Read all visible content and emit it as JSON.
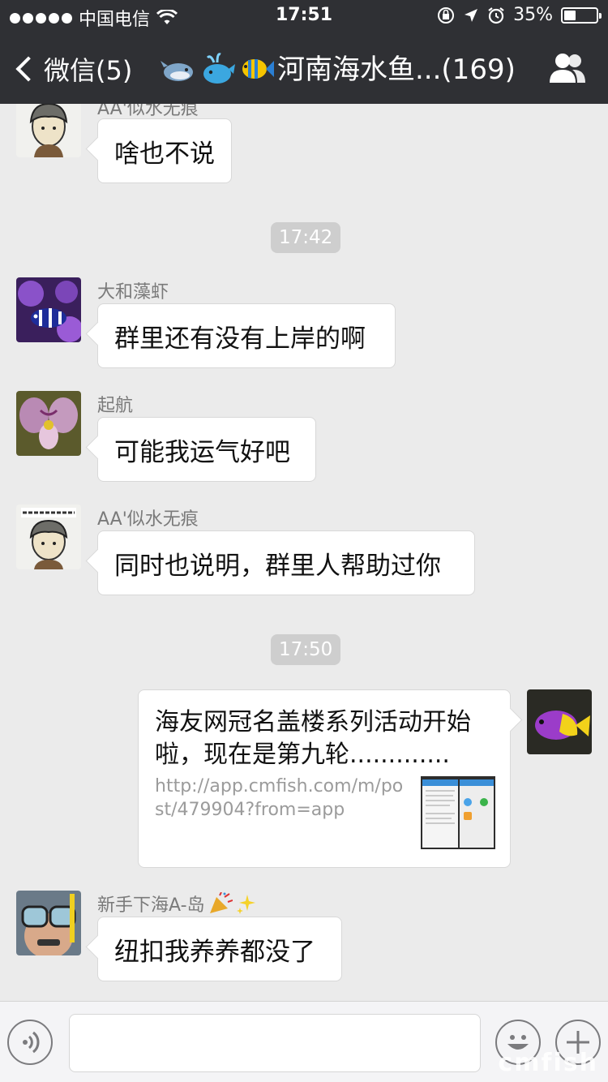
{
  "status_bar": {
    "carrier": "中国电信",
    "time": "17:51",
    "battery": "35%",
    "battery_level": 0.35
  },
  "nav": {
    "back_label": "微信(5)",
    "title": "河南海水鱼...(169)"
  },
  "messages": [
    {
      "sender": "AA'似水无痕",
      "text": "啥也不说"
    },
    {
      "time": "17:42"
    },
    {
      "sender": "大和藻虾",
      "text": "群里还有没有上岸的啊"
    },
    {
      "sender": "起航",
      "text": "可能我运气好吧"
    },
    {
      "sender": "AA'似水无痕",
      "text": "同时也说明，群里人帮助过你"
    },
    {
      "time": "17:50"
    },
    {
      "link_title": "海友网冠名盖楼系列活动开始啦，现在是第九轮.............",
      "link_url": "http://app.cmfish.com/m/post/479904?from=app"
    },
    {
      "sender": "新手下海A-岛",
      "text": "纽扣我养养都没了"
    }
  ],
  "watermark": "cmfish"
}
